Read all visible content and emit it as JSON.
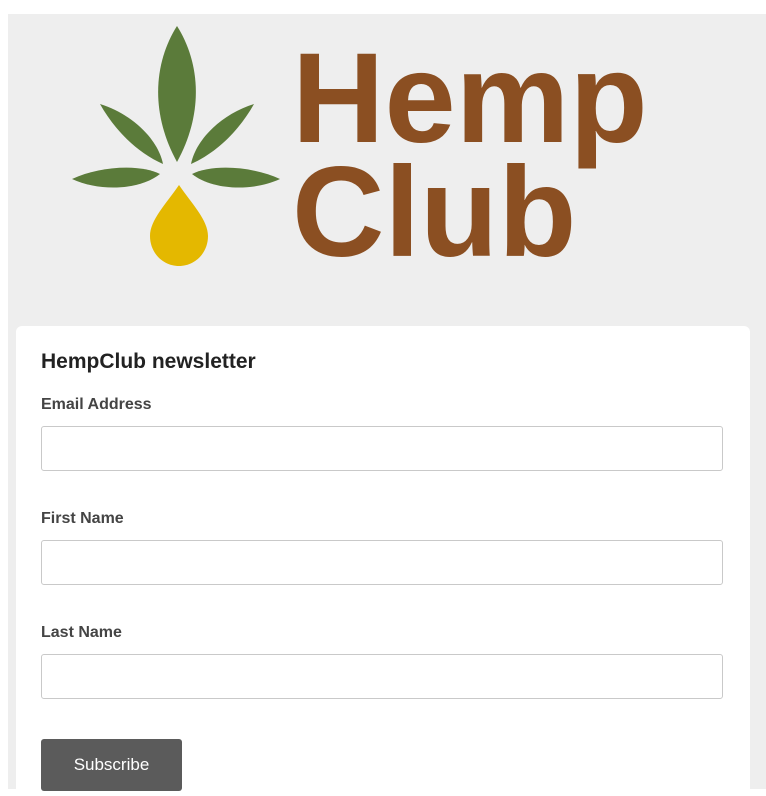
{
  "brand": {
    "logo_word_1": "Hemp",
    "logo_word_2": "Club",
    "leaf_color": "#5b7b3a",
    "drop_color": "#e4b800",
    "text_color": "#8b4f22"
  },
  "form": {
    "title": "HempClub newsletter",
    "fields": [
      {
        "label": "Email Address",
        "value": "",
        "placeholder": ""
      },
      {
        "label": "First Name",
        "value": "",
        "placeholder": ""
      },
      {
        "label": "Last Name",
        "value": "",
        "placeholder": ""
      }
    ],
    "submit_label": "Subscribe"
  }
}
